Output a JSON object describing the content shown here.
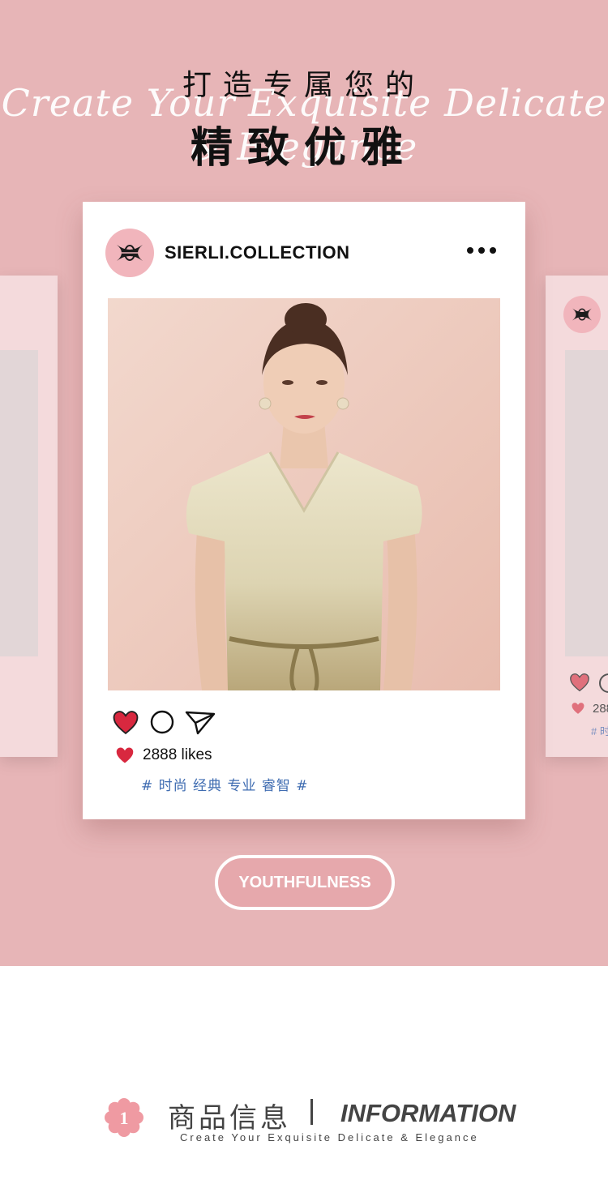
{
  "header": {
    "line1": "打造专属您的",
    "script": "Create Your Exquisite Delicate & Elegance",
    "line2": "精致优雅"
  },
  "post": {
    "username": "SIERLI.COLLECTION",
    "likes": "2888 likes",
    "hashtags": "# 时尚 经典 专业 睿智 #",
    "avatar_icon": "sierli-monogram-logo",
    "icons": [
      "heart-icon",
      "comment-icon",
      "send-icon",
      "more-icon"
    ]
  },
  "side_card_right": {
    "likes_fragment": "288",
    "tag_fragment": "# 时"
  },
  "pill": {
    "label": "YOUTHFULNESS"
  },
  "info": {
    "number": "1",
    "title_cn": "商品信息",
    "title_en": "INFORMATION",
    "subtitle": "Create Your Exquisite Delicate & Elegance"
  },
  "colors": {
    "hero_bg": "#e7b5b7",
    "heart": "#d8283f",
    "hashtag": "#3f6cb1",
    "accent_pink": "#f1b5bc"
  }
}
